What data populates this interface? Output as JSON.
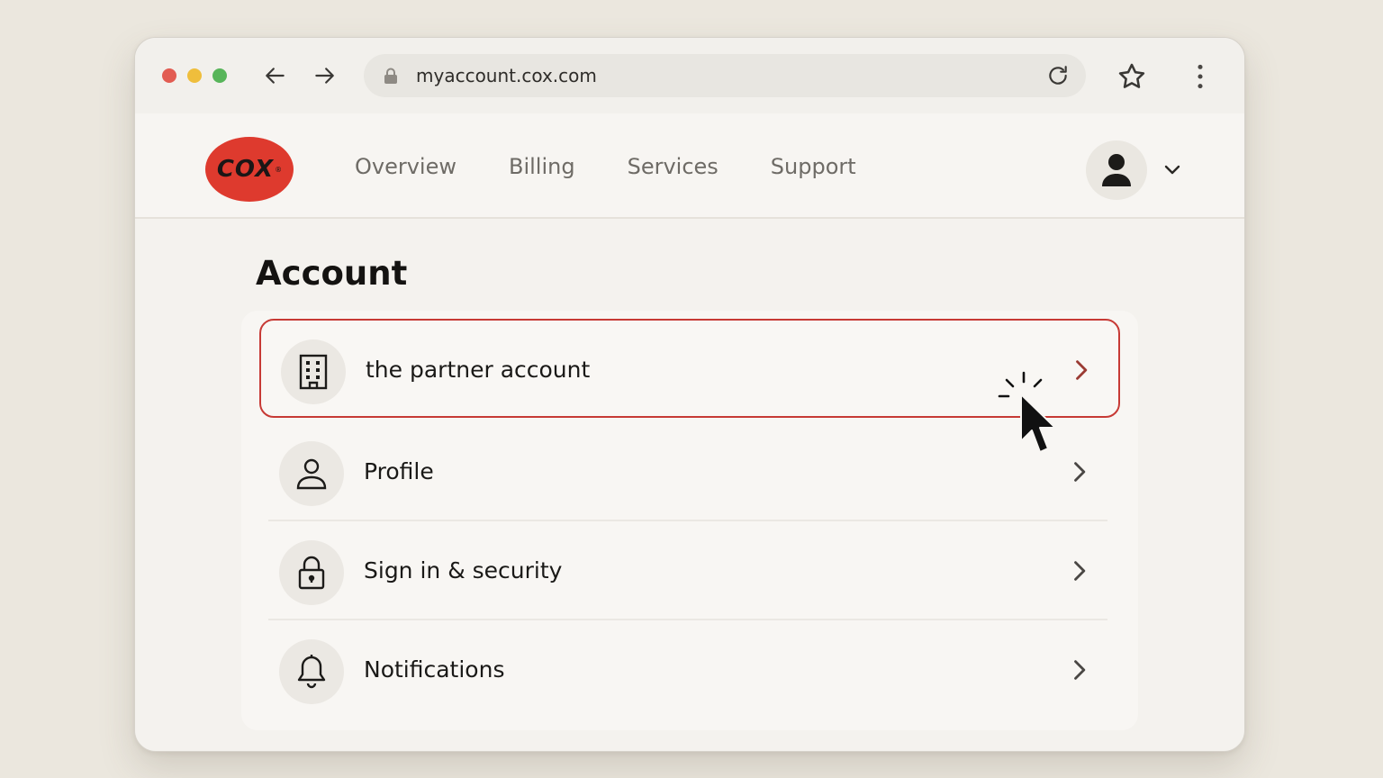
{
  "browser": {
    "url": "myaccount.cox.com",
    "icons": {
      "back": "arrow-left-icon",
      "forward": "arrow-right-icon",
      "lock": "lock-icon",
      "reload": "reload-icon",
      "bookmark": "star-icon",
      "menu": "kebab-menu-icon"
    }
  },
  "header": {
    "logo_text": "COX",
    "nav": [
      "Overview",
      "Billing",
      "Services",
      "Support"
    ],
    "account_icon": "user-avatar-icon",
    "caret_icon": "chevron-down-icon"
  },
  "page": {
    "title": "Account",
    "items": [
      {
        "label": "the partner account",
        "icon": "building-icon",
        "selected": true
      },
      {
        "label": "Profile",
        "icon": "person-icon"
      },
      {
        "label": "Sign in & security",
        "icon": "lock-icon"
      },
      {
        "label": "Notifications",
        "icon": "bell-icon"
      }
    ]
  },
  "colors": {
    "brand_red": "#de3a2e",
    "selection_border": "#c73a35",
    "text_primary": "#1a1917",
    "nav_text": "#6e6b66"
  }
}
